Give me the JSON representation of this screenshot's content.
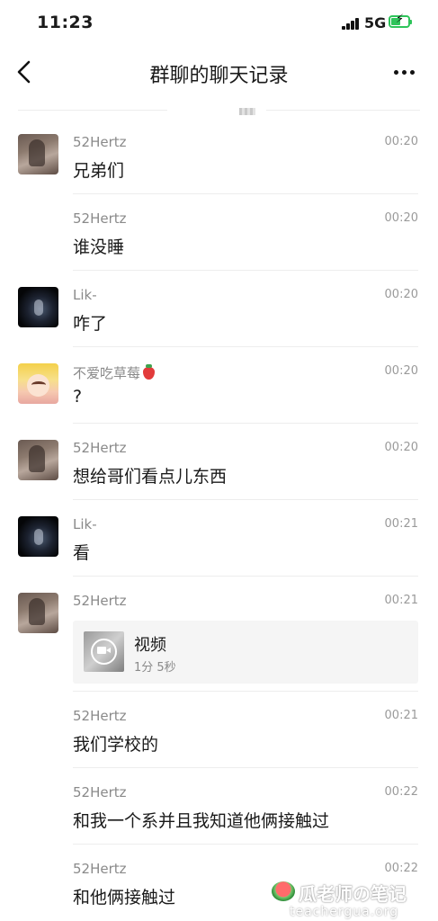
{
  "status_bar": {
    "time": "11:23",
    "network": "5G",
    "colors": {
      "battery": "#2ec45a"
    }
  },
  "nav": {
    "title": "群聊的聊天记录",
    "back_icon": "chevron-left-icon",
    "more_icon": "more-horizontal-icon"
  },
  "messages": [
    {
      "sender": "52Hertz",
      "time": "00:20",
      "text": "兄弟们",
      "avatar": "52hertz"
    },
    {
      "sender": "52Hertz",
      "time": "00:20",
      "text": "谁没睡",
      "avatar": ""
    },
    {
      "sender": "Lik-",
      "time": "00:20",
      "text": "咋了",
      "avatar": "lik"
    },
    {
      "sender": "不爱吃草莓",
      "time": "00:20",
      "text": "?",
      "avatar": "girl"
    },
    {
      "sender": "52Hertz",
      "time": "00:20",
      "text": "想给哥们看点儿东西",
      "avatar": "52hertz"
    },
    {
      "sender": "Lik-",
      "time": "00:21",
      "text": "看",
      "avatar": "lik"
    },
    {
      "sender": "52Hertz",
      "time": "00:21",
      "avatar": "52hertz",
      "video": {
        "title": "视频",
        "duration": "1分 5秒"
      }
    },
    {
      "sender": "52Hertz",
      "time": "00:21",
      "text": "我们学校的",
      "avatar": ""
    },
    {
      "sender": "52Hertz",
      "time": "00:22",
      "text": "和我一个系并且我知道他俩接触过",
      "avatar": ""
    },
    {
      "sender": "52Hertz",
      "time": "00:22",
      "text": "和他俩接触过",
      "avatar": ""
    }
  ],
  "watermark": {
    "brand": "瓜老师の笔记",
    "url": "teachergua.org"
  }
}
